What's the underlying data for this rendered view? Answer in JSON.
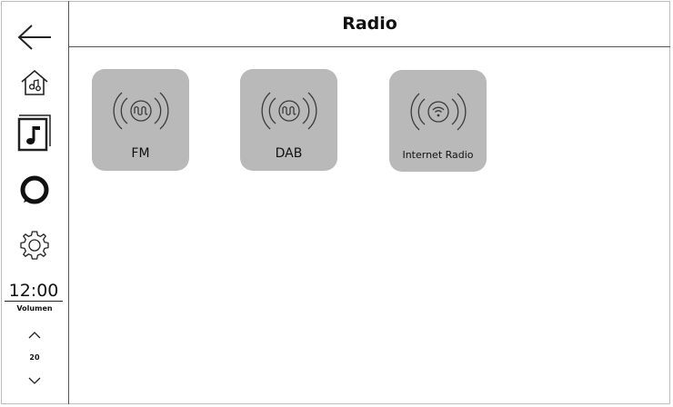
{
  "header": {
    "title": "Radio"
  },
  "sidebar": {
    "back_icon": "arrow-left-icon",
    "home_icon": "home-music-icon",
    "media_icon": "music-note-icon",
    "assistant_icon": "ring-icon",
    "settings_icon": "gear-icon",
    "clock": "12:00",
    "volume": {
      "label": "Volumen",
      "value": "20",
      "up_icon": "chevron-up-icon",
      "down_icon": "chevron-down-icon"
    }
  },
  "sources": [
    {
      "label": "FM",
      "icon": "radio-wave-icon"
    },
    {
      "label": "DAB",
      "icon": "radio-wave-icon"
    },
    {
      "label": "Internet Radio",
      "icon": "wifi-broadcast-icon"
    }
  ],
  "colors": {
    "tile": "#b9b9b9",
    "divider": "#555555"
  }
}
